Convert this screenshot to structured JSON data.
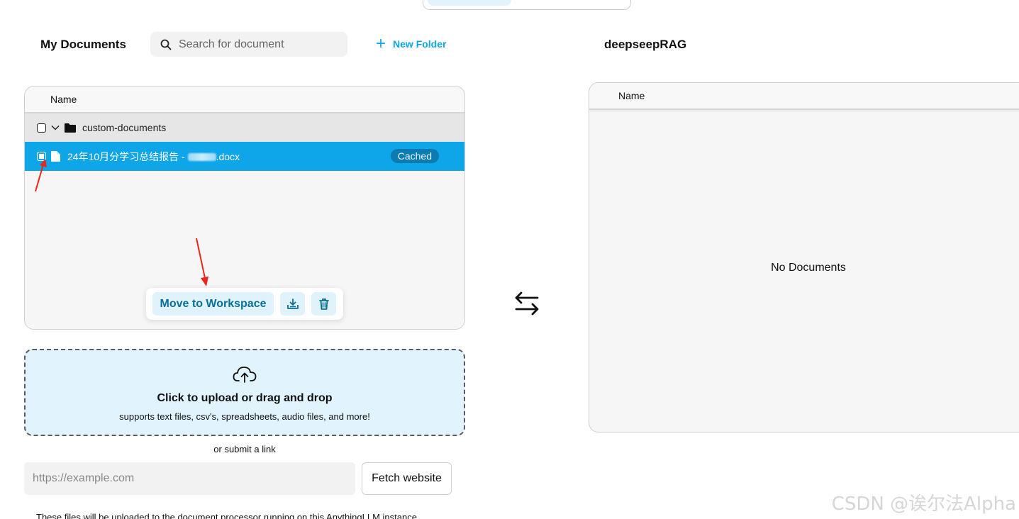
{
  "left": {
    "title": "My Documents",
    "search_placeholder": "Search for document",
    "new_folder_label": "New Folder",
    "column_header": "Name",
    "folder": {
      "name": "custom-documents"
    },
    "file": {
      "name_prefix": "24年10月分学习总结报告 - ",
      "name_suffix": ".docx",
      "status_badge": "Cached"
    },
    "actions": {
      "move_label": "Move to Workspace"
    }
  },
  "right": {
    "title": "deepseepRAG",
    "column_header": "Name",
    "empty_text": "No Documents"
  },
  "upload": {
    "title": "Click to upload or drag and drop",
    "subtitle": "supports text files, csv's, spreadsheets, audio files, and more!",
    "or_link": "or submit a link",
    "url_placeholder": "https://example.com",
    "fetch_label": "Fetch website",
    "footnote": "These files will be uploaded to the document processor running on this AnythingLLM instance."
  },
  "watermark": "CSDN @诶尔法Alpha",
  "colors": {
    "accent": "#0ea5e9",
    "annotation": "#e8271d"
  }
}
